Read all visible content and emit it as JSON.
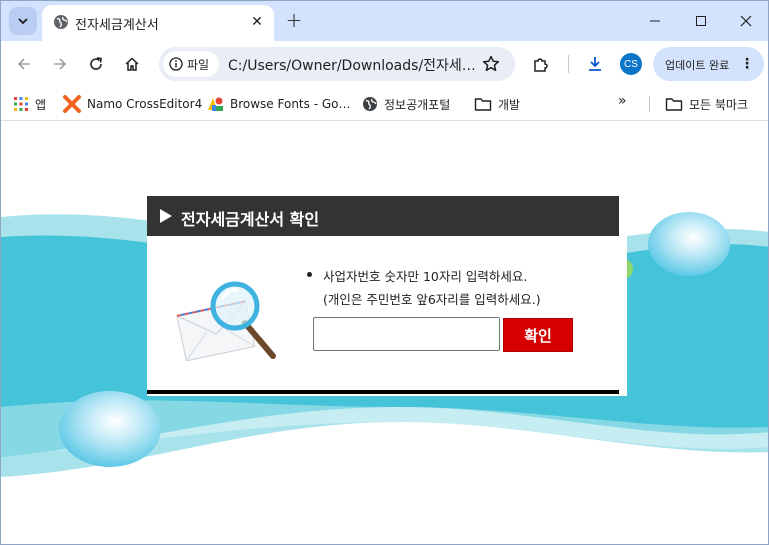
{
  "browser": {
    "tab": {
      "title": "전자세금계산서",
      "favicon": "globe-icon"
    },
    "toolbar": {
      "site_chip_label": "파일",
      "url": "C:/Users/Owner/Downloads/전자세…",
      "avatar_initials": "CS",
      "update_label": "업데이트 완료"
    },
    "bookmarks": [
      {
        "label": "앱",
        "icon": "apps-grid-icon"
      },
      {
        "label": "Namo CrossEditor4",
        "icon": "namo-icon"
      },
      {
        "label": "Browse Fonts - Go…",
        "icon": "google-fonts-icon"
      },
      {
        "label": "정보공개포털",
        "icon": "globe-icon"
      },
      {
        "label": "개발",
        "icon": "folder-icon"
      }
    ],
    "all_bookmarks_label": "모든 북마크"
  },
  "page": {
    "dialog_title": "전자세금계산서 확인",
    "instruction_line1": "사업자번호 숫자만 10자리 입력하세요.",
    "instruction_line2": "(개인은 주민번호 앞6자리를 입력하세요.)",
    "input_value": "",
    "confirm_label": "확인"
  },
  "colors": {
    "header_bg": "#333333",
    "confirm_bg": "#d60000",
    "wave_teal": "#45c3d8",
    "wave_light": "#a8e3ec",
    "tabstrip": "#d3e3fd"
  }
}
